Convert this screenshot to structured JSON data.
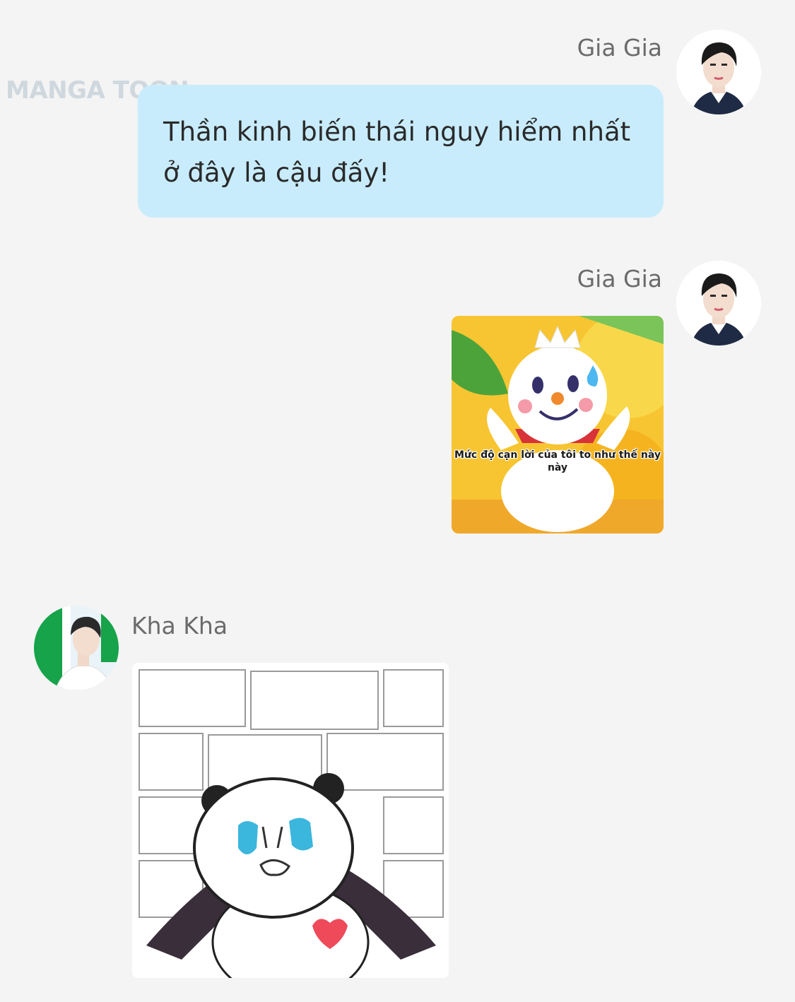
{
  "watermark": {
    "text": "MANGA TOON"
  },
  "messages": [
    {
      "sender": "Gia Gia",
      "side": "right",
      "type": "text",
      "text": "Thần kinh biến thái nguy hiểm nhất ở đây là cậu đấy!"
    },
    {
      "sender": "Gia Gia",
      "side": "right",
      "type": "sticker",
      "sticker": "snowman-sticker",
      "caption": "Mức độ cạn lời của tôi to như thế này này"
    },
    {
      "sender": "Kha Kha",
      "side": "left",
      "type": "sticker",
      "sticker": "crying-panda-sticker"
    }
  ],
  "colors": {
    "background": "#f4f4f4",
    "bubble": "#c8ecfc",
    "sender_name": "#6b6b6b"
  }
}
